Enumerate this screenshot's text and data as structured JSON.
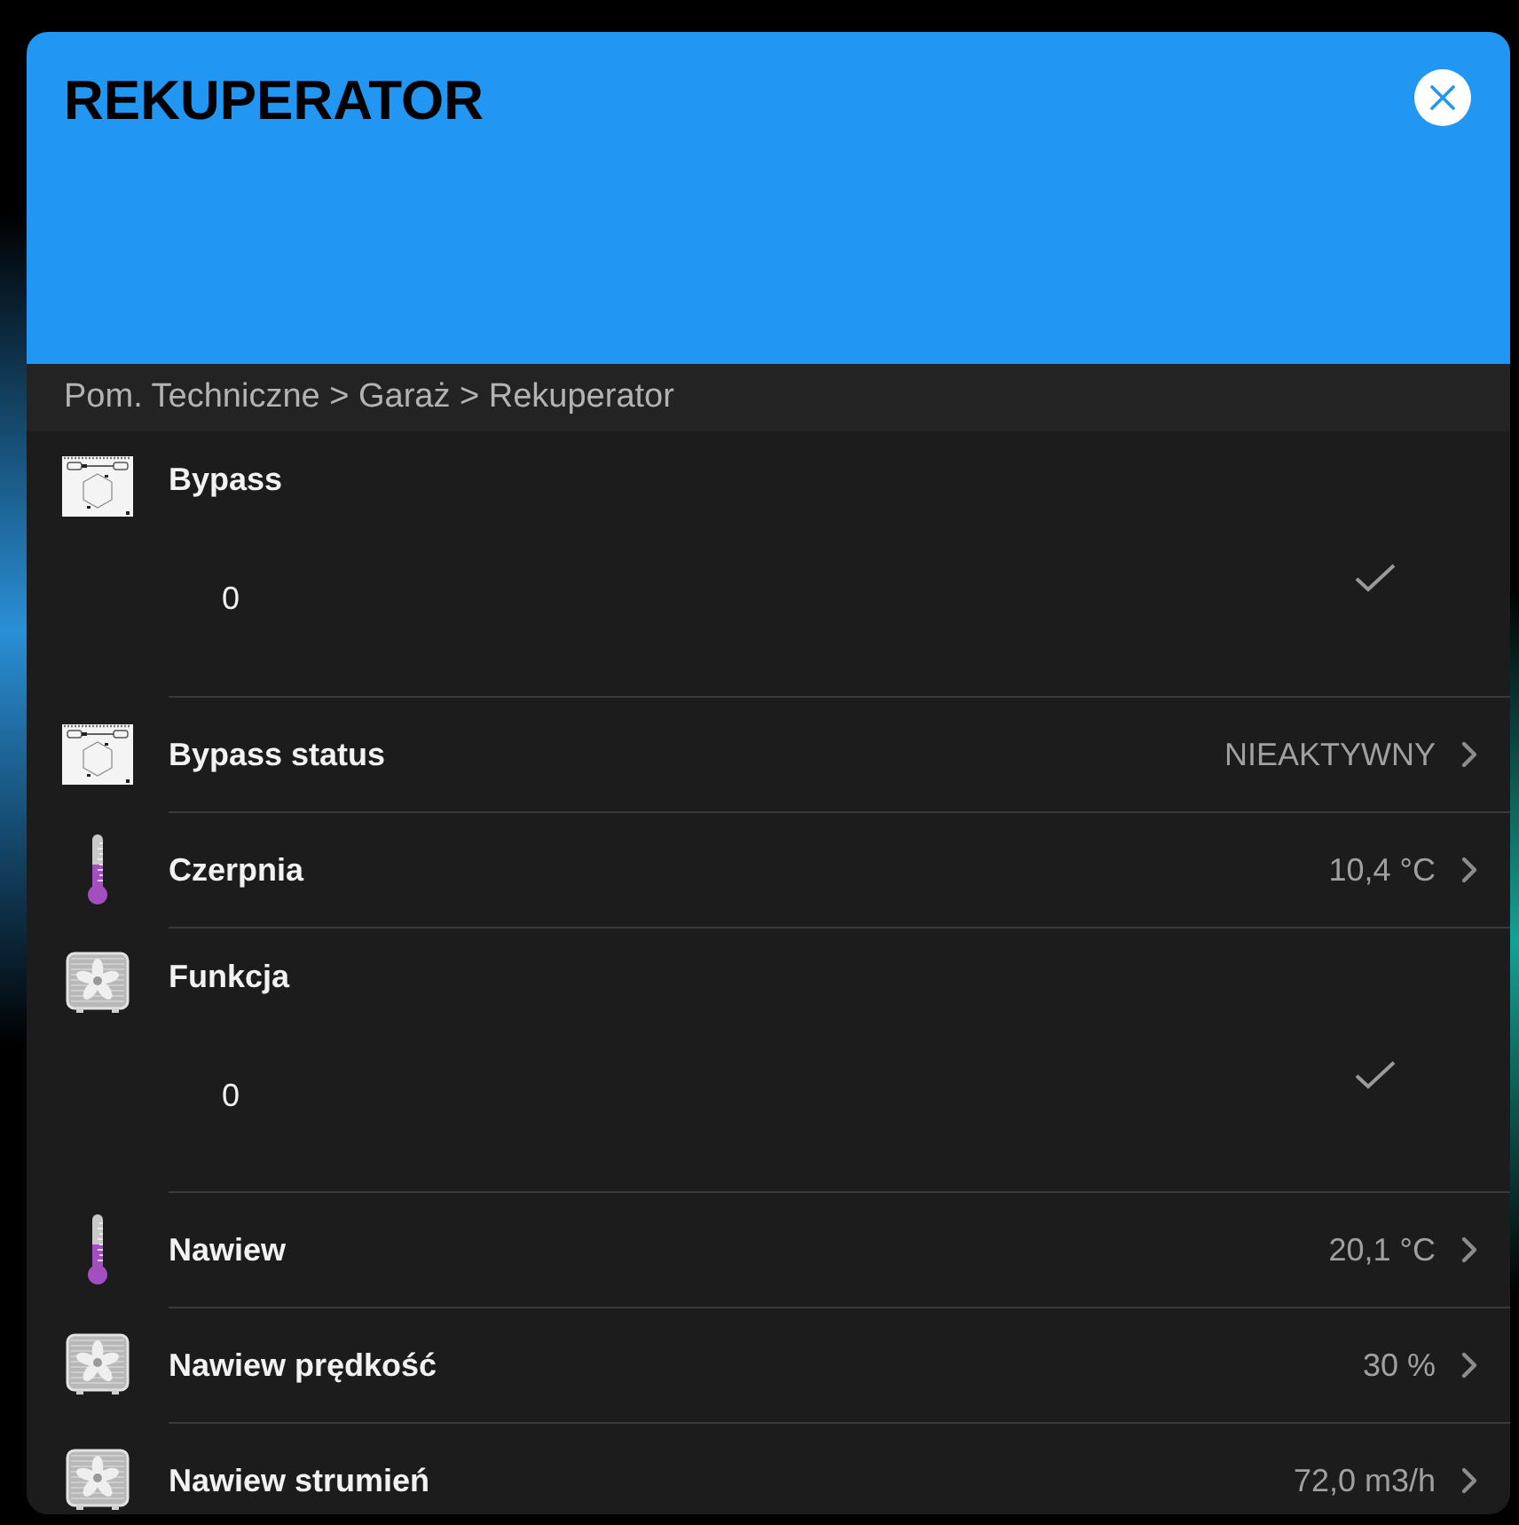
{
  "dialog": {
    "title": "REKUPERATOR",
    "breadcrumb": "Pom. Techniczne > Garaż > Rekuperator"
  },
  "entities": [
    {
      "kind": "input",
      "icon": {
        "kind": "unit"
      },
      "name": "Bypass",
      "value": "0"
    },
    {
      "kind": "sensor",
      "icon": {
        "kind": "unit"
      },
      "name": "Bypass status",
      "value": "NIEAKTYWNY"
    },
    {
      "kind": "sensor",
      "icon": {
        "kind": "thermometer"
      },
      "name": "Czerpnia",
      "value": "10,4 °C"
    },
    {
      "kind": "input",
      "icon": {
        "kind": "fan"
      },
      "name": "Funkcja",
      "value": "0"
    },
    {
      "kind": "sensor",
      "icon": {
        "kind": "thermometer"
      },
      "name": "Nawiew",
      "value": "20,1 °C"
    },
    {
      "kind": "sensor",
      "icon": {
        "kind": "fan"
      },
      "name": "Nawiew prędkość",
      "value": "30 %"
    },
    {
      "kind": "sensor",
      "icon": {
        "kind": "fan"
      },
      "name": "Nawiew strumień",
      "value": "72,0 m3/h"
    }
  ]
}
